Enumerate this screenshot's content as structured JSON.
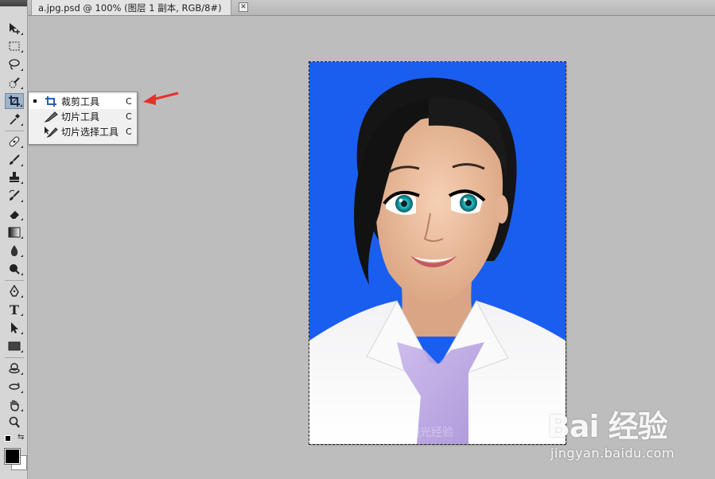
{
  "document_tab": {
    "title": "a.jpg.psd @ 100% (图层 1 副本, RGB/8#)",
    "close_glyph": "✕"
  },
  "toolbar": {
    "tools": [
      {
        "name": "move-tool",
        "icon": "move-icon"
      },
      {
        "name": "marquee-tool",
        "icon": "rect-marquee-icon"
      },
      {
        "name": "lasso-tool",
        "icon": "lasso-icon"
      },
      {
        "name": "quick-selection-tool",
        "icon": "quick-select-icon"
      },
      {
        "name": "crop-tool",
        "icon": "crop-icon",
        "active": true
      },
      {
        "name": "eyedropper-tool",
        "icon": "eyedropper-icon"
      },
      {
        "name": "healing-brush-tool",
        "icon": "bandage-icon"
      },
      {
        "name": "brush-tool",
        "icon": "brush-icon"
      },
      {
        "name": "clone-stamp-tool",
        "icon": "stamp-icon"
      },
      {
        "name": "history-brush-tool",
        "icon": "history-brush-icon"
      },
      {
        "name": "eraser-tool",
        "icon": "eraser-icon"
      },
      {
        "name": "gradient-tool",
        "icon": "gradient-icon"
      },
      {
        "name": "blur-tool",
        "icon": "drop-icon"
      },
      {
        "name": "dodge-tool",
        "icon": "dodge-icon"
      },
      {
        "name": "pen-tool",
        "icon": "pen-icon"
      },
      {
        "name": "type-tool",
        "icon": "type-icon",
        "glyph": "T"
      },
      {
        "name": "path-selection-tool",
        "icon": "arrow-icon"
      },
      {
        "name": "shape-tool",
        "icon": "rectangle-icon"
      },
      {
        "name": "3d-rotate-tool",
        "icon": "3d-rotate-icon"
      },
      {
        "name": "3d-orbit-tool",
        "icon": "3d-orbit-icon"
      },
      {
        "name": "hand-tool",
        "icon": "hand-icon"
      },
      {
        "name": "zoom-tool",
        "icon": "magnifier-icon"
      }
    ],
    "foreground_color": "#000000",
    "background_color": "#ffffff"
  },
  "crop_flyout": {
    "items": [
      {
        "label": "裁剪工具",
        "shortcut": "C",
        "selected": true,
        "icon": "crop-icon"
      },
      {
        "label": "切片工具",
        "shortcut": "C",
        "selected": false,
        "icon": "slice-icon"
      },
      {
        "label": "切片选择工具",
        "shortcut": "C",
        "selected": false,
        "icon": "slice-select-icon"
      }
    ]
  },
  "canvas": {
    "background_color": "#1a5ef0"
  },
  "annotation": {
    "arrow_color": "#e8302a",
    "icon": "red-arrow-icon"
  },
  "watermark": {
    "logo": "Bai 经验",
    "url": "jingyan.baidu.com"
  },
  "photo_watermark": "随光经验"
}
